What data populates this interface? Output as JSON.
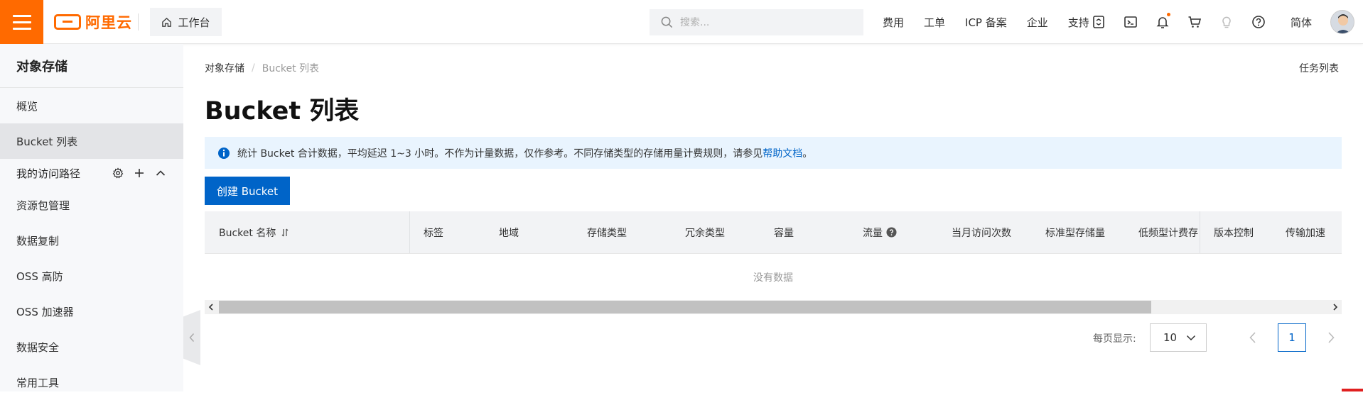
{
  "header": {
    "logo_text": "阿里云",
    "workbench_label": "工作台",
    "search_placeholder": "搜索...",
    "links": [
      "费用",
      "工单",
      "ICP 备案",
      "企业",
      "支持"
    ],
    "lang_label": "简体",
    "accent_color": "#ff6a00"
  },
  "sidebar": {
    "title": "对象存储",
    "items_top": [
      "概览",
      "Bucket 列表"
    ],
    "active_item": "Bucket 列表",
    "group_label": "我的访问路径",
    "items_bottom": [
      "资源包管理",
      "数据复制",
      "OSS 高防",
      "OSS 加速器",
      "数据安全",
      "常用工具"
    ]
  },
  "main": {
    "breadcrumb": [
      "对象存储",
      "Bucket 列表"
    ],
    "task_list_label": "任务列表",
    "page_title": "Bucket 列表",
    "notice_text": "统计 Bucket 合计数据，平均延迟 1~3 小时。不作为计量数据，仅作参考。不同存储类型的存储用量计费规则，请参见",
    "notice_link": "帮助文档",
    "notice_end": "。",
    "create_button": "创建 Bucket",
    "table": {
      "columns": [
        "Bucket 名称",
        "标签",
        "地域",
        "存储类型",
        "冗余类型",
        "容量",
        "流量",
        "当月访问次数",
        "标准型存储量",
        "低频型计费存",
        "版本控制",
        "传输加速"
      ],
      "empty_text": "没有数据"
    },
    "pagination": {
      "per_page_label": "每页显示:",
      "per_page_value": "10",
      "current_page": "1"
    }
  }
}
